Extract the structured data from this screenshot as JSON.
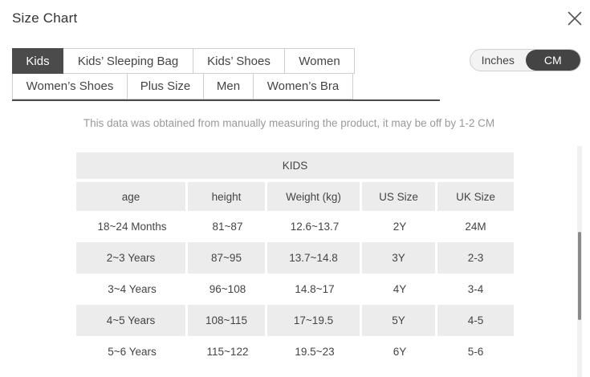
{
  "dialog": {
    "title": "Size Chart"
  },
  "tabs": {
    "row1": [
      "Kids",
      "Kids’ Sleeping Bag",
      "Kids’ Shoes",
      "Women"
    ],
    "row2": [
      "Women’s Shoes",
      "Plus Size",
      "Men",
      "Women’s Bra"
    ],
    "active": "Kids"
  },
  "units": {
    "inches": "Inches",
    "cm": "CM",
    "selected": "CM"
  },
  "note": "This data was obtained from manually measuring the product, it may be off by 1-2 CM",
  "table": {
    "title": "KIDS",
    "headers": [
      "age",
      "height",
      "Weight (kg)",
      "US Size",
      "UK Size"
    ],
    "rows": [
      [
        "18~24 Months",
        "81~87",
        "12.6~13.7",
        "2Y",
        "24M"
      ],
      [
        "2~3 Years",
        "87~95",
        "13.7~14.8",
        "3Y",
        "2-3"
      ],
      [
        "3~4 Years",
        "96~108",
        "14.8~17",
        "4Y",
        "3-4"
      ],
      [
        "4~5 Years",
        "108~115",
        "17~19.5",
        "5Y",
        "4-5"
      ],
      [
        "5~6 Years",
        "115~122",
        "19.5~23",
        "6Y",
        "5-6"
      ]
    ]
  },
  "icons": {
    "close": "close-icon"
  },
  "colors": {
    "active_tab": "#4b4b4b",
    "shade": "#ececec",
    "note_text": "#999999"
  }
}
